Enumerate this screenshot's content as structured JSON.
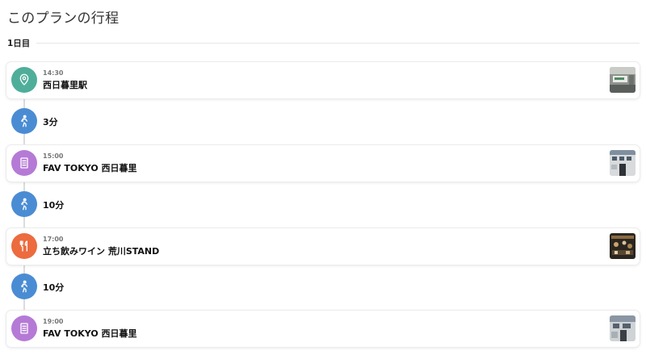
{
  "page": {
    "title": "このプランの行程"
  },
  "day": {
    "label": "1日目"
  },
  "colors": {
    "station": "#4fae9a",
    "hotel": "#b57ad6",
    "restaurant": "#ec6b3f",
    "walk": "#4a8cd3"
  },
  "stops": [
    {
      "time": "14:30",
      "name": "西日暮里駅",
      "icon": "map-pin-icon"
    },
    {
      "time": "15:00",
      "name": "FAV TOKYO 西日暮里",
      "icon": "building-icon"
    },
    {
      "time": "17:00",
      "name": "立ち飲みワイン 荒川STAND",
      "icon": "utensils-icon"
    },
    {
      "time": "19:00",
      "name": "FAV TOKYO 西日暮里",
      "icon": "building-icon"
    }
  ],
  "moves": [
    {
      "duration": "3分",
      "icon": "walking-icon"
    },
    {
      "duration": "10分",
      "icon": "walking-icon"
    },
    {
      "duration": "10分",
      "icon": "walking-icon"
    }
  ]
}
